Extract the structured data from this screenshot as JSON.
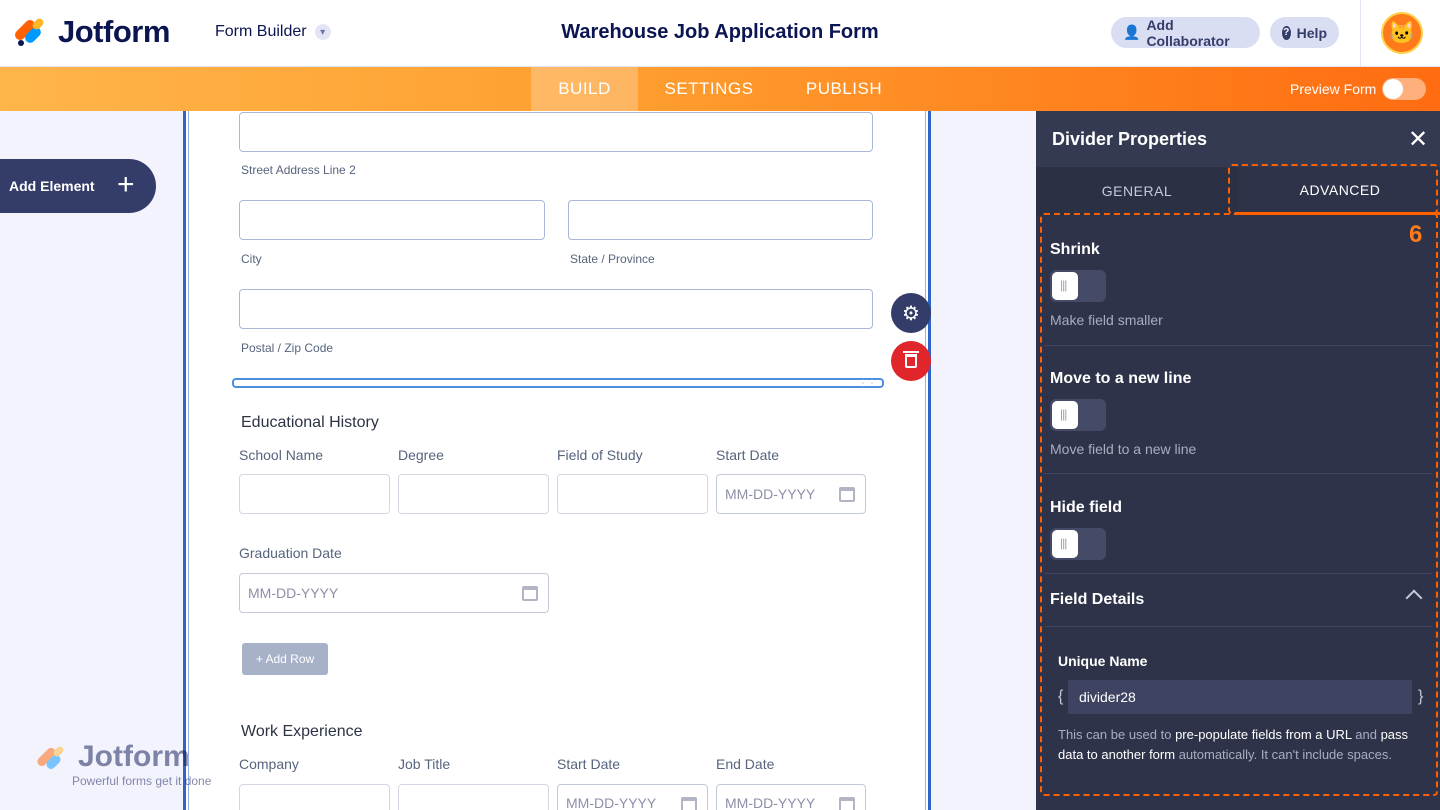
{
  "header": {
    "logo_text": "Jotform",
    "form_builder_label": "Form Builder",
    "form_title": "Warehouse Job Application Form",
    "add_collaborator_label": "Add Collaborator",
    "help_label": "Help"
  },
  "nav": {
    "tabs": [
      {
        "label": "BUILD",
        "active": true
      },
      {
        "label": "SETTINGS",
        "active": false
      },
      {
        "label": "PUBLISH",
        "active": false
      }
    ],
    "preview_label": "Preview Form",
    "preview_on": false
  },
  "sidebar": {
    "add_element_label": "Add Element"
  },
  "form": {
    "address": {
      "street2_label": "Street Address Line 2",
      "city_label": "City",
      "state_label": "State / Province",
      "postal_label": "Postal / Zip Code"
    },
    "education": {
      "heading": "Educational History",
      "columns": [
        "School Name",
        "Degree",
        "Field of Study",
        "Start Date"
      ],
      "date_placeholder": "MM-DD-YYYY",
      "graduation_label": "Graduation Date",
      "add_row_label": "+ Add Row"
    },
    "work": {
      "heading": "Work Experience",
      "columns": [
        "Company",
        "Job Title",
        "Start Date",
        "End Date"
      ],
      "date_placeholder": "MM-DD-YYYY"
    }
  },
  "watermark": {
    "name": "Jotform",
    "tagline": "Powerful forms get it done"
  },
  "panel": {
    "title": "Divider Properties",
    "tabs": {
      "general": "GENERAL",
      "advanced": "ADVANCED"
    },
    "step_number": "6",
    "shrink": {
      "title": "Shrink",
      "desc": "Make field smaller",
      "on": false
    },
    "new_line": {
      "title": "Move to a new line",
      "desc": "Move field to a new line",
      "on": false
    },
    "hide": {
      "title": "Hide field",
      "on": false
    },
    "field_details_title": "Field Details",
    "unique_name_label": "Unique Name",
    "unique_name_value": "divider28",
    "help_part1": "This can be used to ",
    "help_part2": "pre-populate fields from a URL",
    "help_part3": " and ",
    "help_part4": "pass data to another form",
    "help_part5": " automatically. It can't include spaces."
  },
  "colors": {
    "accent": "#ff6100",
    "nav_dark": "#0a1551",
    "panel_bg": "#2e3349",
    "selection_blue": "#2f64c9",
    "delete_red": "#e0252b"
  }
}
